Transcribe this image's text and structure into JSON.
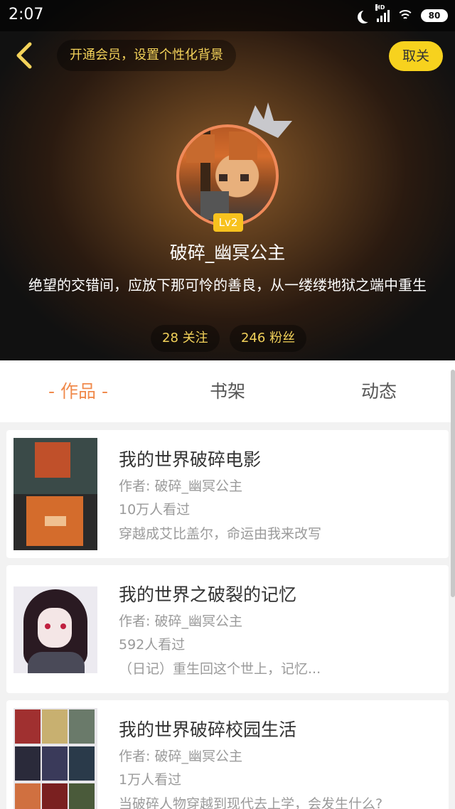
{
  "status_bar": {
    "time": "2:07",
    "battery": "80",
    "network": "HD"
  },
  "header": {
    "vip_banner": "开通会员，设置个性化背景",
    "unfollow_label": "取关",
    "level": "Lv2",
    "user_name": "破碎_幽冥公主",
    "bio": "绝望的交错间，应放下那可怜的善良，从一缕缕地狱之端中重生",
    "following": "28 关注",
    "fans": "246 粉丝"
  },
  "tabs": [
    {
      "label": "- 作品 -",
      "active": true
    },
    {
      "label": "书架",
      "active": false
    },
    {
      "label": "动态",
      "active": false
    }
  ],
  "works": [
    {
      "title": "我的世界破碎电影",
      "author": "作者: 破碎_幽冥公主",
      "views": "10万人看过",
      "desc": "穿越成艾比盖尔，命运由我来改写"
    },
    {
      "title": "我的世界之破裂的记忆",
      "author": "作者: 破碎_幽冥公主",
      "views": "592人看过",
      "desc": "（日记）重生回这个世上，记忆..."
    },
    {
      "title": "我的世界破碎校园生活",
      "author": "作者: 破碎_幽冥公主",
      "views": "1万人看过",
      "desc": "当破碎人物穿越到现代去上学，会发生什么?"
    }
  ],
  "colors": {
    "accent": "#f08a4c",
    "vip_yellow": "#f7d21e",
    "banner_text": "#f3d25a"
  }
}
